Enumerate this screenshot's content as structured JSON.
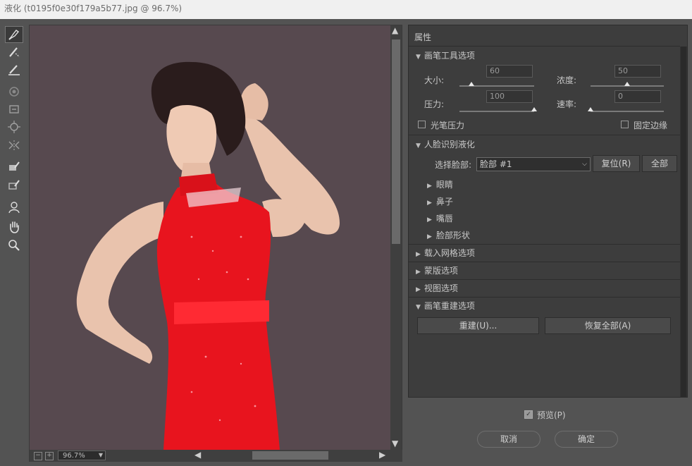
{
  "window": {
    "title": "液化 (t0195f0e30f179a5b77.jpg @ 96.7%)"
  },
  "tools": [
    {
      "name": "forward-warp-tool-icon"
    },
    {
      "name": "reconstruct-tool-icon"
    },
    {
      "name": "smooth-tool-icon"
    },
    {
      "name": "twirl-clockwise-tool-icon"
    },
    {
      "name": "pucker-tool-icon"
    },
    {
      "name": "bloat-tool-icon"
    },
    {
      "name": "push-left-tool-icon"
    },
    {
      "name": "freeze-mask-tool-icon"
    },
    {
      "name": "thaw-mask-tool-icon"
    },
    {
      "name": "face-tool-icon"
    },
    {
      "name": "hand-tool-icon"
    },
    {
      "name": "zoom-tool-icon"
    }
  ],
  "canvas": {
    "zoom": "96.7%",
    "background": "#57494f",
    "dress_color": "#e8141e"
  },
  "panel": {
    "title": "属性",
    "brush_tool_options": {
      "heading": "画笔工具选项",
      "size_label": "大小:",
      "size_value": "60",
      "size_fraction": 0.16,
      "density_label": "浓度:",
      "density_value": "50",
      "density_fraction": 0.5,
      "pressure_label": "压力:",
      "pressure_value": "100",
      "pressure_fraction": 1.0,
      "rate_label": "速率:",
      "rate_value": "0",
      "rate_fraction": 0.0,
      "stylus_pressure_label": "光笔压力",
      "pin_edges_label": "固定边缘"
    },
    "face_aware": {
      "heading": "人脸识别液化",
      "select_face_label": "选择脸部:",
      "select_face_value": "脸部 #1",
      "reset_label": "复位(R)",
      "all_label": "全部",
      "items": [
        "眼睛",
        "鼻子",
        "嘴唇",
        "脸部形状"
      ]
    },
    "load_mesh_options": "载入网格选项",
    "mask_options": "蒙版选项",
    "view_options": "视图选项",
    "brush_reconstruct_options": {
      "heading": "画笔重建选项",
      "reconstruct_label": "重建(U)...",
      "restore_all_label": "恢复全部(A)"
    }
  },
  "footer": {
    "preview_label": "预览(P)",
    "preview_checked": true,
    "cancel_label": "取消",
    "ok_label": "确定"
  }
}
